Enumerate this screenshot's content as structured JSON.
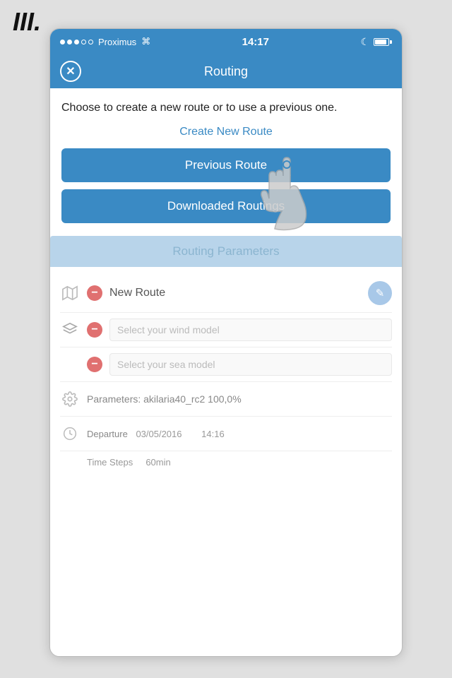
{
  "roman": "III.",
  "status_bar": {
    "carrier": "Proximus",
    "wifi": "wifi",
    "time": "14:17",
    "battery": "full"
  },
  "header": {
    "title": "Routing",
    "close_label": "×"
  },
  "intro_text": "Choose to create a new route or to use a previous one.",
  "create_new_link": "Create New Route",
  "previous_route_btn": "Previous Route",
  "downloaded_routings_btn": "Downloaded Routings",
  "routing_params": {
    "header": "Routing Parameters",
    "route_name": "New Route",
    "wind_model_placeholder": "Select your wind model",
    "sea_model_placeholder": "Select your sea model",
    "parameters_text": "Parameters: akilaria40_rc2 100,0%",
    "departure_label": "Departure",
    "departure_date": "03/05/2016",
    "departure_time": "14:16",
    "timesteps_label": "Time Steps",
    "timesteps_value": "60min"
  }
}
